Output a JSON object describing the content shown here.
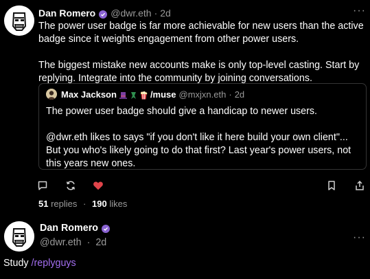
{
  "post": {
    "author_name": "Dan Romero",
    "handle": "@dwr.eth",
    "dot": "·",
    "time": "2d",
    "more": "···",
    "paragraphs": [
      "The power user badge is far more achievable for new users than the active badge since it weights engagement from other power users.",
      "The biggest mistake new accounts make is only top-level casting. Start by replying. Integrate into the community by joining conversations."
    ],
    "quote": {
      "author_name": "Max Jackson",
      "channel": "/muse",
      "handle": "@mxjxn.eth",
      "dot": "·",
      "time": "2d",
      "paragraphs": [
        "The power user badge should give a handicap to newer users.",
        "@dwr.eth  likes to says \"if you don't like it here build your own client\"... But you who's likely going to do that first? Last year's power users, not this years new ones."
      ]
    },
    "actions": {
      "reply_icon": "reply-icon",
      "recast_icon": "recast-icon",
      "like_icon": "heart-icon",
      "bookmark_icon": "bookmark-icon",
      "share_icon": "share-icon",
      "liked_color": "#e0444a"
    },
    "stats": {
      "replies_count": "51",
      "replies_label": "replies",
      "sep": "·",
      "likes_count": "190",
      "likes_label": "likes"
    }
  },
  "post2": {
    "author_name": "Dan Romero",
    "handle": "@dwr.eth",
    "dot": "·",
    "time": "2d",
    "more": "···",
    "text": "Study",
    "channel_tag": "/replyguys"
  },
  "colors": {
    "background": "#000000",
    "verified_badge": "#8a63d2",
    "channel_link": "#a36ef0",
    "muted_text": "#9a9a9a"
  }
}
